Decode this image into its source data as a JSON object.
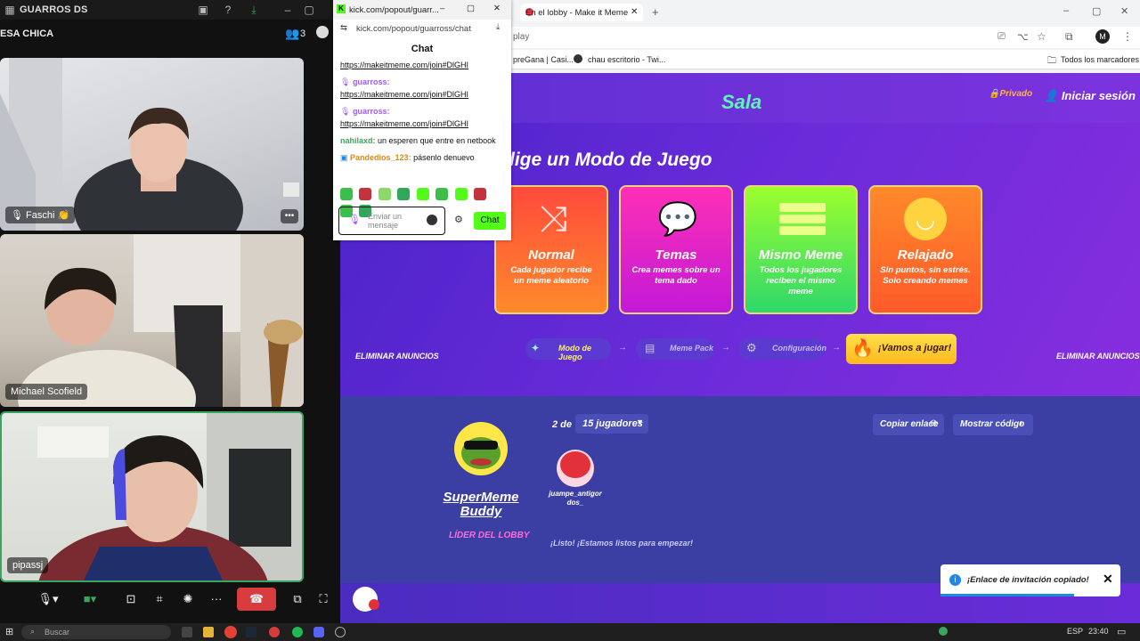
{
  "call": {
    "title": "GUARROS DS",
    "channel": "ESA CHICA",
    "participant_count": "3",
    "participants": [
      {
        "name": "Faschi 👏"
      },
      {
        "name": "Michael Scofield"
      },
      {
        "name": "pipassj"
      }
    ]
  },
  "chat": {
    "window_title": "kick.com/popout/guarr...",
    "url": "kick.com/popout/guarross/chat",
    "header": "Chat",
    "messages": [
      {
        "user": "",
        "text": "https://makeitmeme.com/join#DlGHI"
      },
      {
        "user": "guarross:",
        "text": "https://makeitmeme.com/join#DlGHI"
      },
      {
        "user": "guarross:",
        "text": "https://makeitmeme.com/join#DlGHI"
      },
      {
        "user": "nahilaxd:",
        "text": "un esperen que entre en netbook"
      },
      {
        "user": "Pandedios_123:",
        "text": "pásenlo denuevo"
      }
    ],
    "input_placeholder": "Enviar un mensaje",
    "send_label": "Chat",
    "colors": {
      "accent": "#53fc18"
    }
  },
  "browser": {
    "tab_title": "En el lobby - Make it Meme",
    "url_fragment": "play",
    "bookmarks": [
      "preGana | Casi...",
      "chau escritorio - Twi..."
    ],
    "all_bookmarks": "Todos los marcadores"
  },
  "game": {
    "room_title": "Sala",
    "private_label": "Privado",
    "login_label": "Iniciar sesión",
    "choose_mode": "lige un Modo de Juego",
    "modes": [
      {
        "title": "Normal",
        "desc": "Cada jugador recibe un meme aleatorio"
      },
      {
        "title": "Temas",
        "desc": "Crea memes sobre un tema dado"
      },
      {
        "title": "Mismo Meme",
        "desc": "Todos los jugadores reciben el mismo meme"
      },
      {
        "title": "Relajado",
        "desc": "Sin puntos, sin estrés. Solo creando memes"
      }
    ],
    "ad_left": "ELIMINAR ANUNCIOS",
    "ad_right": "ELIMINAR ANUNCIOS",
    "steps": [
      "Modo de Juego",
      "Meme Pack",
      "Configuración"
    ],
    "play_button": "¡Vamos a jugar!",
    "players_count": "2 de",
    "players_max": "15 jugadores",
    "copy_link": "Copiar enlace",
    "show_code": "Mostrar código",
    "leader_name": "SuperMeme Buddy",
    "leader_role": "LÍDER DEL LOBBY",
    "player2_name": "juampe_antigor dos_",
    "ready_text": "¡Listo! ¡Estamos listos para empezar!",
    "toast_text": "¡Enlace de invitación copiado!"
  },
  "taskbar": {
    "search_placeholder": "Buscar",
    "language": "ESP",
    "time": "23:40"
  }
}
